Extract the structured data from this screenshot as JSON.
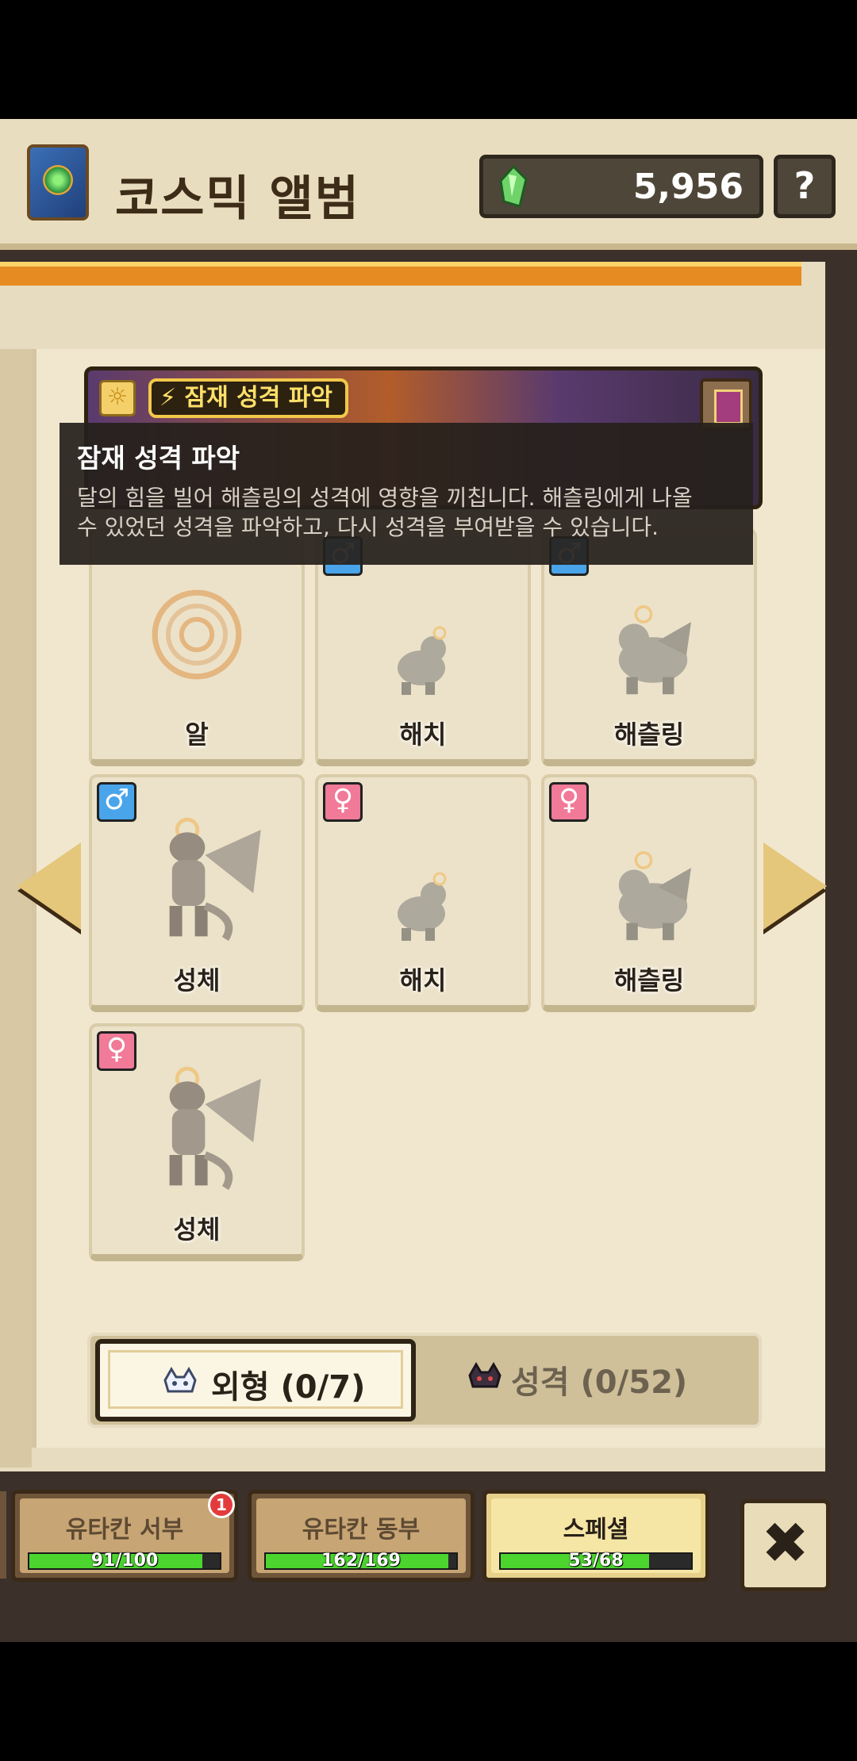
{
  "header": {
    "title": "코스믹 앨범",
    "currency_value": "5,956",
    "help_label": "?"
  },
  "banner": {
    "tag_label": "⚡ 잠재 성격 파악"
  },
  "tooltip": {
    "title": "잠재 성격 파악",
    "body_line1": "달의 힘을 빌어 해츨링의 성격에 영향을 끼칩니다. 해츨링에게 나올",
    "body_line2": "수 있었던 성격을 파악하고, 다시 성격을 부여받을 수 있습니다."
  },
  "cards": [
    {
      "label": "알",
      "gender": "",
      "icon": "egg"
    },
    {
      "label": "해치",
      "gender": "male",
      "icon": "hatch"
    },
    {
      "label": "해츨링",
      "gender": "male",
      "icon": "hatchling"
    },
    {
      "label": "성체",
      "gender": "male",
      "icon": "adult"
    },
    {
      "label": "해치",
      "gender": "female",
      "icon": "hatch"
    },
    {
      "label": "해츨링",
      "gender": "female",
      "icon": "hatchling"
    },
    {
      "label": "성체",
      "gender": "female",
      "icon": "adult"
    }
  ],
  "gender_symbols": {
    "male": "♂",
    "female": "♀"
  },
  "tabs": {
    "appearance_label": "외형 (0/7)",
    "personality_label": "성격 (0/52)"
  },
  "regions": [
    {
      "name": "유타칸 서부",
      "count": "91/100",
      "progress": 0.91,
      "badge": "1"
    },
    {
      "name": "유타칸 동부",
      "count": "162/169",
      "progress": 0.9586
    },
    {
      "name": "스페셜",
      "count": "53/68",
      "progress": 0.7794
    }
  ],
  "close_label": "✖",
  "colors": {
    "accent_orange": "#e58b22",
    "progress_green": "#4bd52e",
    "male_blue": "#4aa4ea",
    "female_pink": "#f07a98"
  }
}
